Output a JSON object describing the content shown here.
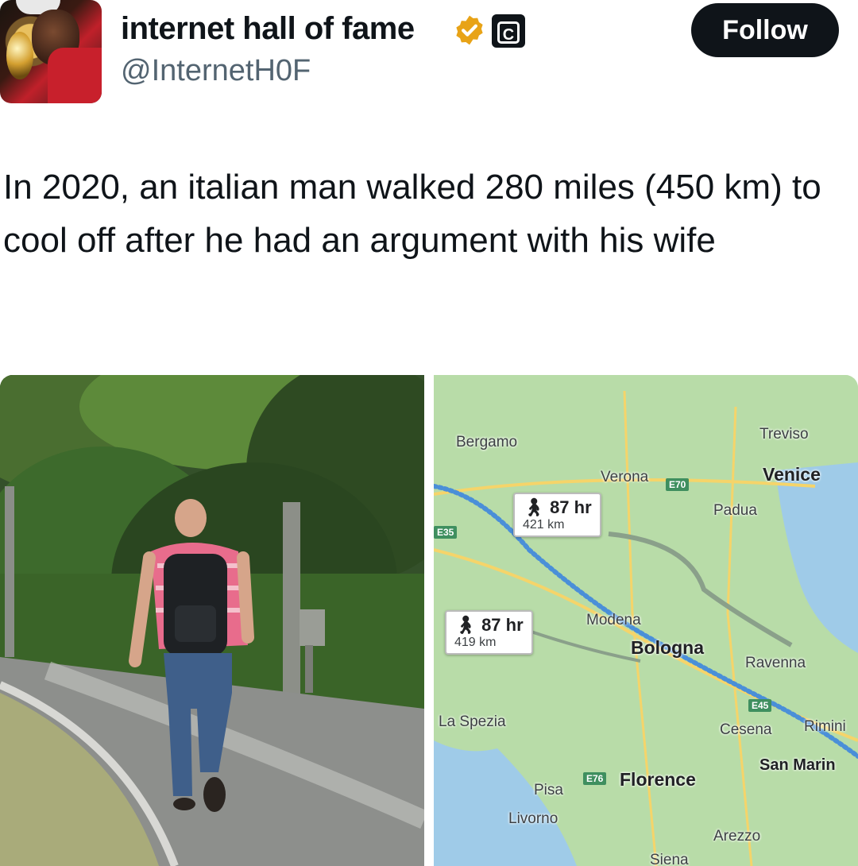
{
  "author": {
    "display_name": "internet hall of fame",
    "handle": "@InternetH0F",
    "badge_letter": "C",
    "verified_color": "#e8a317"
  },
  "follow_label": "Follow",
  "post": {
    "text": "In 2020, an italian man walked 280 miles (450 km) to cool off after he had an argument with his wife"
  },
  "map": {
    "cities": {
      "bergamo": "Bergamo",
      "treviso": "Treviso",
      "verona": "Verona",
      "venice": "Venice",
      "padua": "Padua",
      "modena": "Modena",
      "bologna": "Bologna",
      "ravenna": "Ravenna",
      "la_spezia": "La Spezia",
      "cesena": "Cesena",
      "rimini": "Rimini",
      "san_marino": "San Marin",
      "pisa": "Pisa",
      "florence": "Florence",
      "livorno": "Livorno",
      "arezzo": "Arezzo",
      "siena": "Siena"
    },
    "shields": {
      "e70": "E70",
      "e35": "E35",
      "e45": "E45",
      "e76": "E76"
    },
    "routes": [
      {
        "time": "87 hr",
        "distance": "421 km"
      },
      {
        "time": "87 hr",
        "distance": "419 km"
      }
    ],
    "colors": {
      "land": "#b8dca8",
      "water": "#9fcbe8",
      "route": "#4a8fd8",
      "road": "#f5d46a"
    }
  }
}
